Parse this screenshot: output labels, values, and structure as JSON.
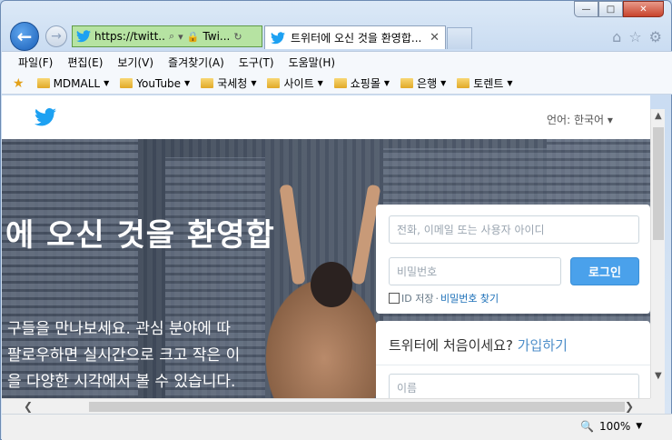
{
  "window": {
    "minimize": "—",
    "maximize": "□",
    "close": "✕"
  },
  "address_bar": {
    "url": "https://twitt...",
    "site_name": "Twi..."
  },
  "tab": {
    "title": "트위터에 오신 것을 환영합...",
    "close": "✕"
  },
  "menu": [
    "파일(F)",
    "편집(E)",
    "보기(V)",
    "즐겨찾기(A)",
    "도구(T)",
    "도움말(H)"
  ],
  "favorites": [
    "MDMALL",
    "YouTube",
    "국세청",
    "사이트",
    "쇼핑몰",
    "은행",
    "토렌트"
  ],
  "page": {
    "language_label": "언어: 한국어 ▾",
    "hero_title": "에 오신 것을 환영합",
    "hero_lines": [
      "구들을 만나보세요. 관심 분야에 따",
      "팔로우하면 실시간으로 크고 작은 이",
      "을 다양한 시각에서 볼 수 있습니다."
    ],
    "login": {
      "username_placeholder": "전화, 이메일 또는 사용자 아이디",
      "password_placeholder": "비밀번호",
      "login_button": "로그인",
      "remember": "ID 저장",
      "separator": "·",
      "forgot": "비밀번호 찾기"
    },
    "signup": {
      "question": "트위터에 처음이세요?",
      "link": "가입하기",
      "name_placeholder": "이름"
    }
  },
  "status": {
    "zoom": "100%"
  },
  "colors": {
    "twitter_blue": "#1da1f2",
    "login_button": "#4aa1eb",
    "address_bar": "#b6e3a2"
  }
}
